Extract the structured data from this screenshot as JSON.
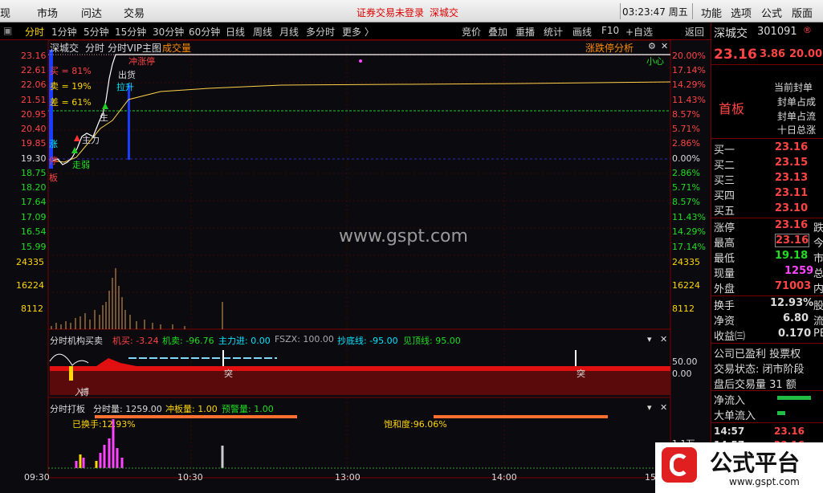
{
  "menu": {
    "left_cut": "现",
    "items": [
      "市场",
      "问达",
      "交易"
    ],
    "notice": "证券交易未登录",
    "stock": "深城交",
    "time": "03:23:47",
    "weekday": "周五",
    "right": [
      "功能",
      "选项",
      "公式",
      "版面"
    ]
  },
  "toolbar": {
    "periods": [
      "分时",
      "1分钟",
      "5分钟",
      "15分钟",
      "30分钟",
      "60分钟",
      "日线",
      "周线",
      "月线",
      "多分时",
      "更多 〉"
    ],
    "right": [
      "竞价",
      "叠加",
      "重播",
      "统计",
      "画线",
      "F10",
      "+自选",
      "返回"
    ]
  },
  "chart": {
    "name": "深城交",
    "mode": "分时",
    "main": "分时VIP主图",
    "vol": "成交量",
    "right_title": "涨跌停分析",
    "left_prices": [
      "23.16",
      "22.61",
      "22.06",
      "21.51",
      "20.95",
      "20.40",
      "19.85",
      "19.30",
      "18.75",
      "18.20",
      "17.64",
      "17.09",
      "16.54",
      "15.99"
    ],
    "right_pcts": [
      "20.00%",
      "17.14%",
      "14.29%",
      "11.43%",
      "8.57%",
      "5.71%",
      "2.86%",
      "0.00%",
      "2.86%",
      "5.71%",
      "8.57%",
      "11.43%",
      "14.29%",
      "17.14%"
    ],
    "vol_left": [
      "24335",
      "16224",
      "8112"
    ],
    "vol_right": [
      "24335",
      "16224",
      "8112"
    ],
    "buy": "买 = 81%",
    "sell": "卖 = 19%",
    "diff": "差 = 61%",
    "zhang": "涨",
    "ting": "停",
    "ban": "板",
    "labels": {
      "zhuli": "主力",
      "zouruo": "走弱",
      "sheng": "生",
      "chuhuo": "出货",
      "lasheng": "拉升",
      "chongzhangting": "冲涨停",
      "xiaoxin": "小心"
    },
    "watermark": "www.gspt.com"
  },
  "ind1": {
    "title": "分时机构买卖",
    "j_buy": "机买: -3.24",
    "j_sell": "机卖: -96.76",
    "zljin": "主力进: 0.00",
    "fszx": "FSZX: 100.00",
    "chaodi": "抄底线: -95.00",
    "jianding": "见顶线: 95.00",
    "r1": "50.00",
    "r2": "0.00",
    "tu": "突",
    "ru": "入",
    "bo": "搏"
  },
  "ind2": {
    "title": "分时打板",
    "fsl": "分时量: 1259.00",
    "cbl": "冲板量: 1.00",
    "yjl": "预警量: 1.00",
    "hsl": "已换手:12.93%",
    "bhd": "饱和度:96.06%",
    "r1": "1.1万"
  },
  "timeaxis": [
    "09:30",
    "10:30",
    "13:00",
    "14:00",
    "15"
  ],
  "quote": {
    "name": "深城交",
    "code": "301091",
    "price": "23.16",
    "chg": "3.86",
    "pct": "20.00",
    "fengdan": [
      "当前封单",
      "封单占成",
      "封单占流",
      "十日总涨"
    ],
    "shouban": "首板",
    "book": [
      {
        "k": "买一",
        "v": "23.16"
      },
      {
        "k": "买二",
        "v": "23.15"
      },
      {
        "k": "买三",
        "v": "23.13"
      },
      {
        "k": "买四",
        "v": "23.11"
      },
      {
        "k": "买五",
        "v": "23.10"
      }
    ],
    "stats": [
      {
        "k": "涨停",
        "v": "23.16",
        "x": "跌",
        "c": "#ff4444"
      },
      {
        "k": "最高",
        "v": "23.16",
        "x": "今",
        "c": "#ff4444"
      },
      {
        "k": "最低",
        "v": "19.18",
        "x": "市",
        "c": "#22dd22"
      },
      {
        "k": "现量",
        "v": "1259",
        "x": "总",
        "c": "#ff44ff"
      },
      {
        "k": "外盘",
        "v": "71003",
        "x": "内",
        "c": "#ff4444"
      }
    ],
    "stats2": [
      {
        "k": "换手",
        "v": "12.93%",
        "x": "股",
        "c": "#dcdcdc"
      },
      {
        "k": "净资",
        "v": "6.80",
        "x": "流",
        "c": "#dcdcdc"
      },
      {
        "k": "收益㈢",
        "v": "0.170",
        "x": "PE",
        "c": "#dcdcdc"
      }
    ],
    "info": [
      "公司已盈利 投票权",
      "交易状态: 闭市阶段",
      "盘后交易量 31 额"
    ],
    "flow": [
      "净流入",
      "大单流入"
    ],
    "ticks": [
      {
        "t": "14:57",
        "p": "23.16"
      },
      {
        "t": "14:57",
        "p": "23.16"
      }
    ]
  },
  "logo": {
    "text": "公式平台",
    "url": "www.gspt.com"
  }
}
